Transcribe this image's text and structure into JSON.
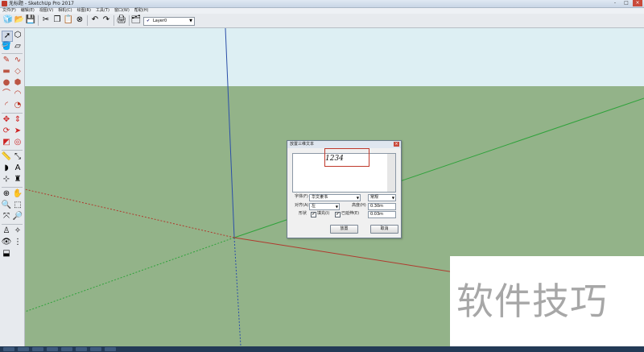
{
  "window": {
    "title": "无标题 - SketchUp Pro 2017",
    "buttons": [
      "-",
      "□",
      "×"
    ]
  },
  "menu": [
    "文件(F)",
    "编辑(E)",
    "视图(V)",
    "相机(C)",
    "绘图(R)",
    "工具(T)",
    "窗口(W)",
    "帮助(H)"
  ],
  "toolbar": {
    "layer_value": "Layer0",
    "layer_check": "✔",
    "dropdown_arrow": "▼"
  },
  "dialog": {
    "title": "放置三维文本",
    "close": "×",
    "text_value": "1234",
    "font_label": "字体(F)",
    "font_value": "华文隶书",
    "style_value": "常规",
    "align_label": "对齐(A)",
    "align_value": "左",
    "height_label": "高度(H)",
    "height_value": "0.30m",
    "form_label": "形状",
    "fill_label": "填充(I)",
    "extruded_label": "已延伸(E)",
    "extrude_value": "0.03m",
    "checked": "✔",
    "place_button": "放置",
    "cancel_button": "取消"
  },
  "watermark": "软件技巧",
  "colors": {
    "sky": "#ddeff3",
    "ground": "#93b389",
    "axis_blue": "#2b4fa8",
    "axis_green": "#2fa23b",
    "axis_red": "#b03a2e"
  }
}
